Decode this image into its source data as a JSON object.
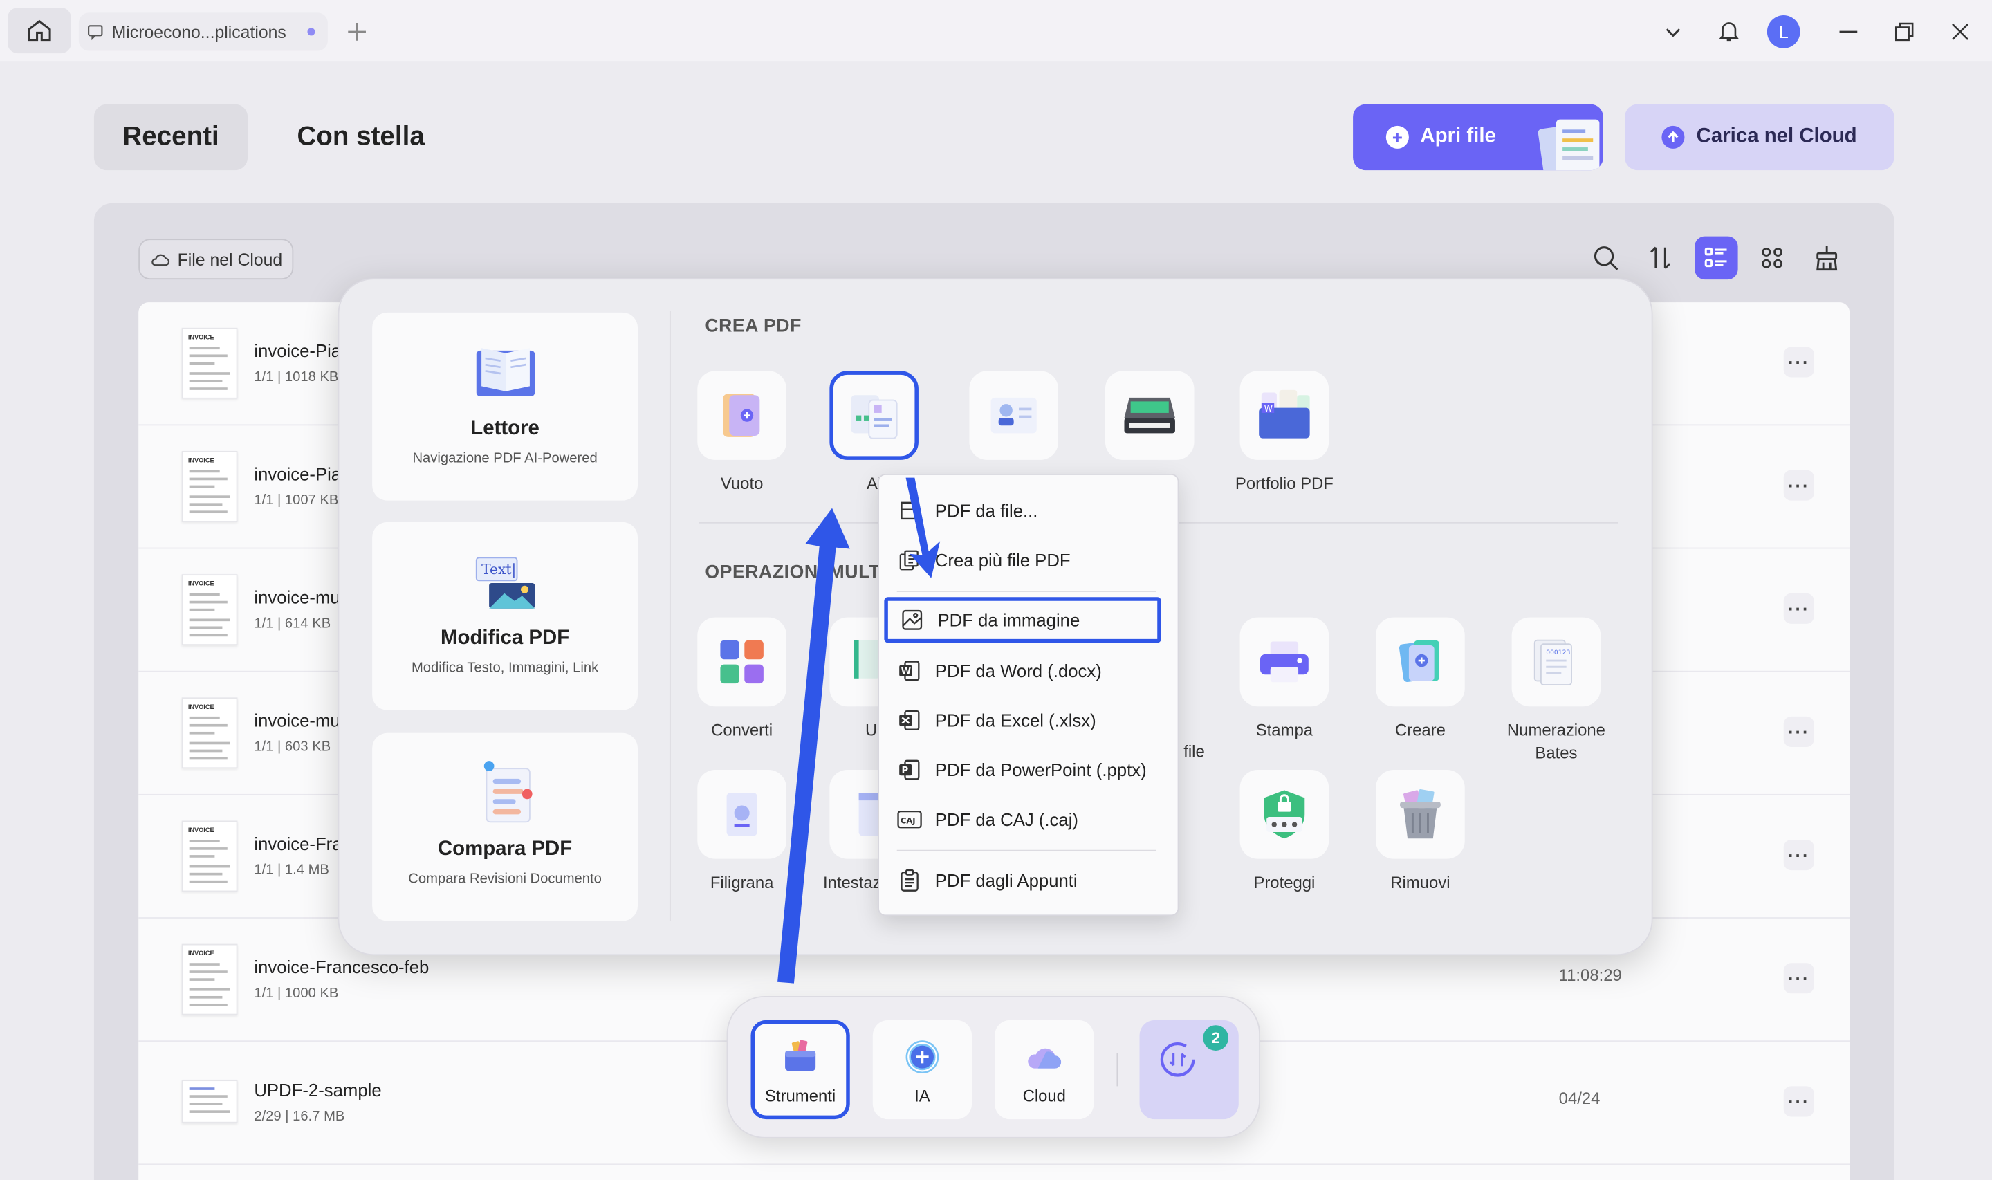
{
  "titlebar": {
    "tab_title": "Microecono...plications"
  },
  "user": {
    "avatar_letter": "L"
  },
  "header": {
    "tab_recent": "Recenti",
    "tab_starred": "Con stella",
    "open_file": "Apri file",
    "upload_cloud": "Carica nel Cloud"
  },
  "toolbar": {
    "cloud_files": "File nel Cloud"
  },
  "files": [
    {
      "name": "invoice-Pia",
      "meta": "1/1 | 1018 KB",
      "time": ""
    },
    {
      "name": "invoice-Pia",
      "meta": "1/1 | 1007 KB",
      "time": ""
    },
    {
      "name": "invoice-mu",
      "meta": "1/1 | 614 KB",
      "time": ""
    },
    {
      "name": "invoice-mu",
      "meta": "1/1 | 603 KB",
      "time": ""
    },
    {
      "name": "invoice-Fra",
      "meta": "1/1 | 1.4 MB",
      "time": ""
    },
    {
      "name": "invoice-Francesco-feb",
      "meta": "1/1 | 1000 KB",
      "time": "11:08:29"
    },
    {
      "name": "UPDF-2-sample",
      "meta": "2/29 | 16.7 MB",
      "time": "04/24"
    }
  ],
  "popup": {
    "cards": [
      {
        "title": "Lettore",
        "subtitle": "Navigazione PDF AI-Powered"
      },
      {
        "title": "Modifica PDF",
        "subtitle": "Modifica Testo, Immagini, Link"
      },
      {
        "title": "Compara PDF",
        "subtitle": "Compara Revisioni Documento"
      }
    ],
    "section_create": "CREA PDF",
    "section_batch": "OPERAZIONI MULT",
    "create_tools": [
      "Vuoto",
      "Al",
      "",
      "",
      "Portfolio PDF"
    ],
    "batch_tools_row1": [
      "Converti",
      "Ur",
      "file",
      "Stampa",
      "Creare",
      "Numerazione Bates"
    ],
    "batch_tools_row2": [
      "Filigrana",
      "Intestazi di pa",
      "Proteggi",
      "Rimuovi"
    ]
  },
  "menu": {
    "items": [
      "PDF da file...",
      "Crea più file PDF",
      "PDF da immagine",
      "PDF da Word (.docx)",
      "PDF da Excel (.xlsx)",
      "PDF da PowerPoint (.pptx)",
      "PDF da CAJ (.caj)",
      "PDF dagli Appunti"
    ]
  },
  "dock": {
    "tools": "Strumenti",
    "ai": "IA",
    "cloud": "Cloud",
    "badge": "2"
  },
  "colors": {
    "accent": "#6a64f5",
    "highlight": "#2f56e8",
    "badge": "#2fb5a2"
  }
}
